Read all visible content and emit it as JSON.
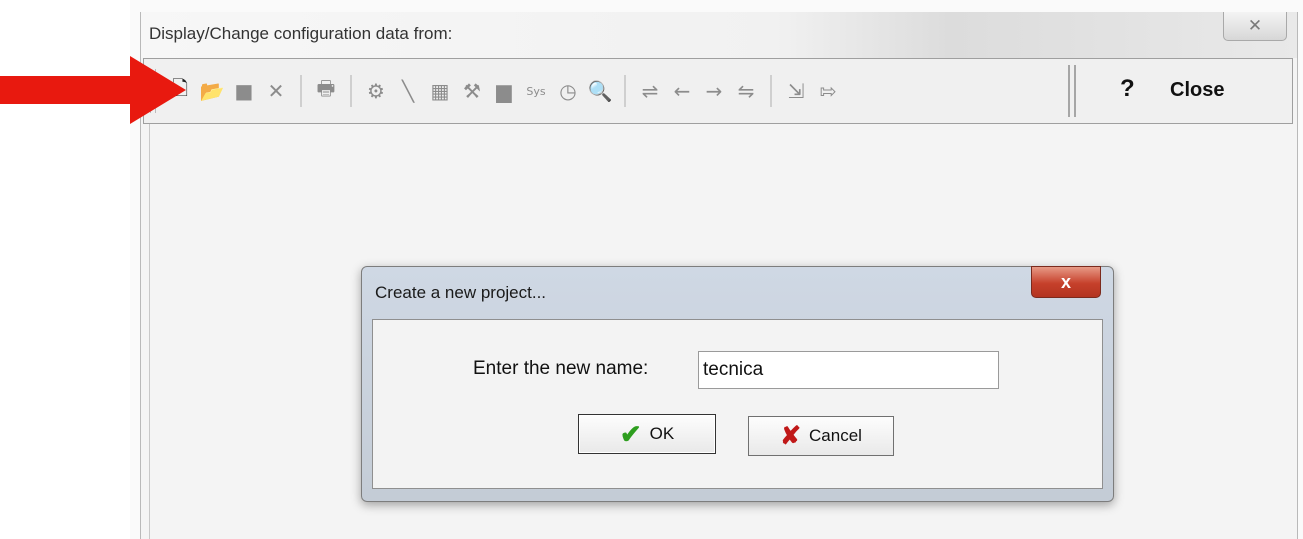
{
  "window": {
    "title": "Display/Change configuration data from:",
    "close_glyph": "✕"
  },
  "toolbar": {
    "buttons": [
      {
        "name": "new-file-icon",
        "glyph": "🗋"
      },
      {
        "name": "open-folder-icon",
        "glyph": "📂"
      },
      {
        "name": "save-icon",
        "glyph": "■"
      },
      {
        "name": "delete-icon",
        "glyph": "✕"
      },
      {
        "name": "print-icon",
        "glyph": "🖶"
      },
      {
        "name": "network-icon",
        "glyph": "⚙"
      },
      {
        "name": "line-icon",
        "glyph": "╲"
      },
      {
        "name": "grid-icon",
        "glyph": "▦"
      },
      {
        "name": "tools-icon",
        "glyph": "⚒"
      },
      {
        "name": "monitor-icon",
        "glyph": "▆"
      },
      {
        "name": "sys-icon",
        "glyph": "Sys"
      },
      {
        "name": "gauge-icon",
        "glyph": "◷"
      },
      {
        "name": "search-icon",
        "glyph": "🔍"
      },
      {
        "name": "insert-icon",
        "glyph": "⇌"
      },
      {
        "name": "arrow-left-icon",
        "glyph": "←"
      },
      {
        "name": "arrow-right-icon",
        "glyph": "→"
      },
      {
        "name": "insert-right-icon",
        "glyph": "⇋"
      },
      {
        "name": "import-icon",
        "glyph": "⇲"
      },
      {
        "name": "export-icon",
        "glyph": "⇰"
      }
    ],
    "help_label": "?",
    "close_label": "Close"
  },
  "dialog": {
    "title": "Create a new project...",
    "close_glyph": "x",
    "name_label": "Enter the new name:",
    "name_value": "tecnica",
    "ok_label": "OK",
    "cancel_label": "Cancel"
  },
  "colors": {
    "arrow": "#e8190f",
    "ok_check": "#2e9e1f",
    "cancel_x": "#c01818",
    "dialog_close": "#c6402b"
  }
}
